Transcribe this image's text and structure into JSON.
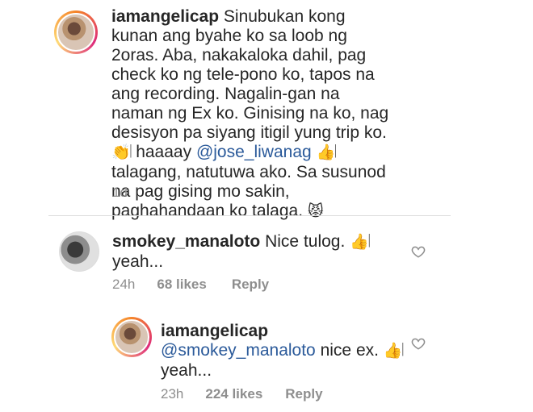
{
  "comments": [
    {
      "username": "iamangelicap",
      "text_before": "Sinubukan kong kunan ang byahe ko sa loob ng 2oras. Aba, nakakaloka dahil, pag check ko ng tele-pono ko, tapos na ang recording. Nagalin-gan na naman ng Ex ko. Ginising na ko, nag desisyon pa siyang itigil yung trip ko. ",
      "emoji_1": "👏",
      "glyph_1": "𝄀",
      "text_mid_1": " haaaay ",
      "mention": "@jose_liwanag",
      "emoji_2": "👍",
      "glyph_2": "𝄀",
      "text_mid_2": " talagang, natutuwa ako. Sa susunod na pag gising mo sakin, paghahandaan ko talaga. ",
      "emoji_3": "😾",
      "time": "1d"
    },
    {
      "username": "smokey_manaloto",
      "text_before": "Nice tulog. ",
      "emoji_1": "👍",
      "glyph_1": "𝄀",
      "text_after": "yeah...",
      "time": "24h",
      "likes": "68 likes",
      "reply": "Reply"
    },
    {
      "username": "iamangelicap",
      "mention": "@smokey_manaloto",
      "text_mid": " nice ex. ",
      "emoji_1": "👍",
      "glyph_1": "𝄀",
      "text_after": "yeah...",
      "time": "23h",
      "likes": "224 likes",
      "reply": "Reply"
    }
  ],
  "icons": {
    "like": "heart-outline-icon"
  },
  "colors": {
    "mention": "#2b5a9a",
    "meta": "#8e8e8e",
    "text": "#262626"
  }
}
